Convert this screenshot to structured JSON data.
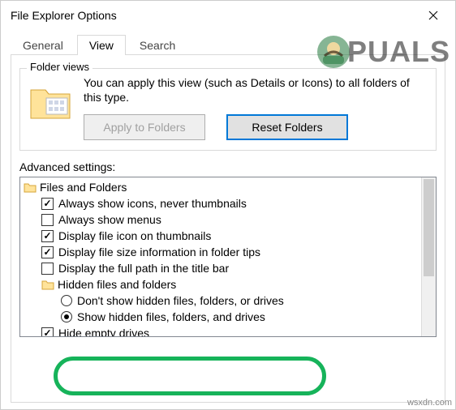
{
  "window": {
    "title": "File Explorer Options"
  },
  "tabs": {
    "general": "General",
    "view": "View",
    "search": "Search"
  },
  "folderViews": {
    "legend": "Folder views",
    "text": "You can apply this view (such as Details or Icons) to all folders of this type.",
    "apply": "Apply to Folders",
    "reset": "Reset Folders"
  },
  "advanced": {
    "label": "Advanced settings:",
    "root": "Files and Folders",
    "items": {
      "always_icons": "Always show icons, never thumbnails",
      "always_menus": "Always show menus",
      "file_icon_thumb": "Display file icon on thumbnails",
      "file_size_tips": "Display file size information in folder tips",
      "full_path_title": "Display the full path in the title bar",
      "hidden_group": "Hidden files and folders",
      "dont_show_hidden": "Don't show hidden files, folders, or drives",
      "show_hidden": "Show hidden files, folders, and drives",
      "hide_empty_drives": "Hide empty drives"
    }
  },
  "watermark": {
    "text": "PUALS"
  },
  "credit": "wsxdn.com"
}
